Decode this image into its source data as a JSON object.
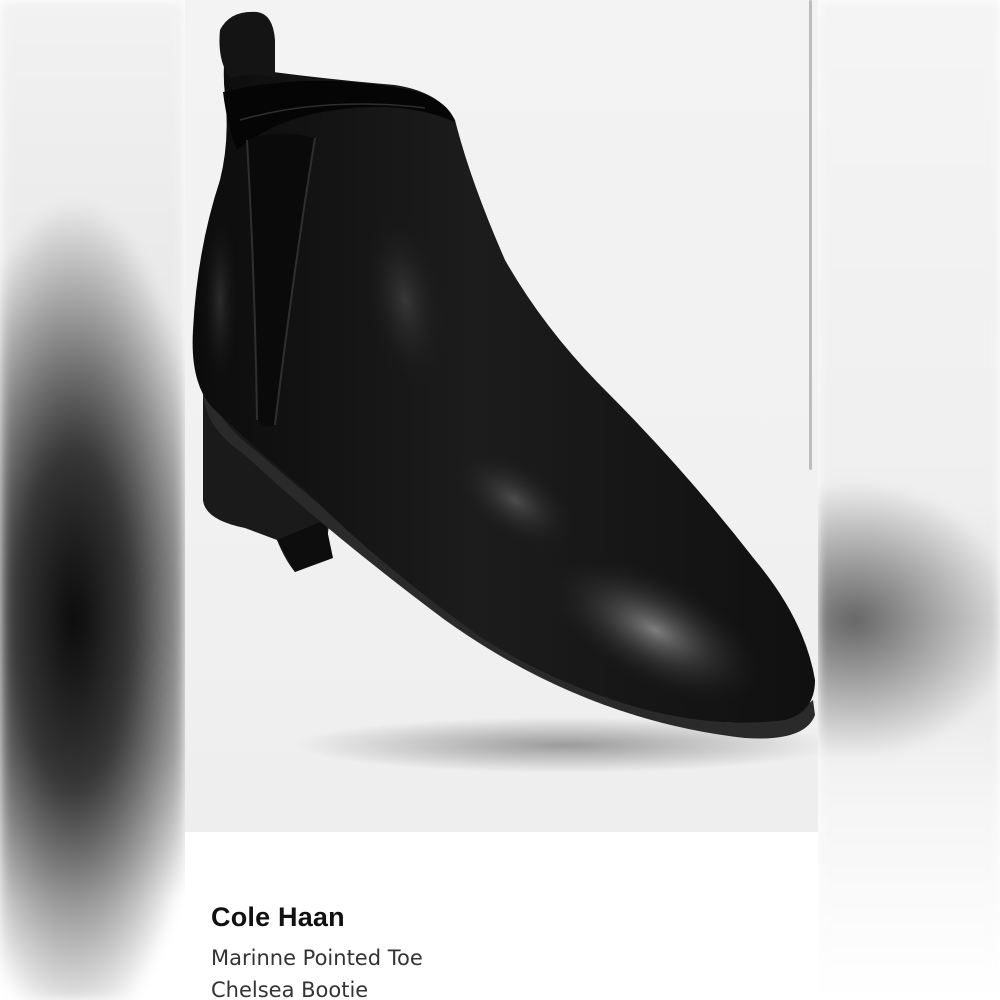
{
  "product": {
    "brand": "Cole Haan",
    "name_lines": [
      "Marinne Pointed Toe",
      "Chelsea Bootie"
    ]
  },
  "image": {
    "subject": "black leather chelsea bootie",
    "icon": "product-photo"
  },
  "colors": {
    "card_background": "#ffffff",
    "photo_background": "#f1f1f1",
    "boot": "#151515",
    "brand_text": "#111111",
    "name_text": "#333333"
  }
}
